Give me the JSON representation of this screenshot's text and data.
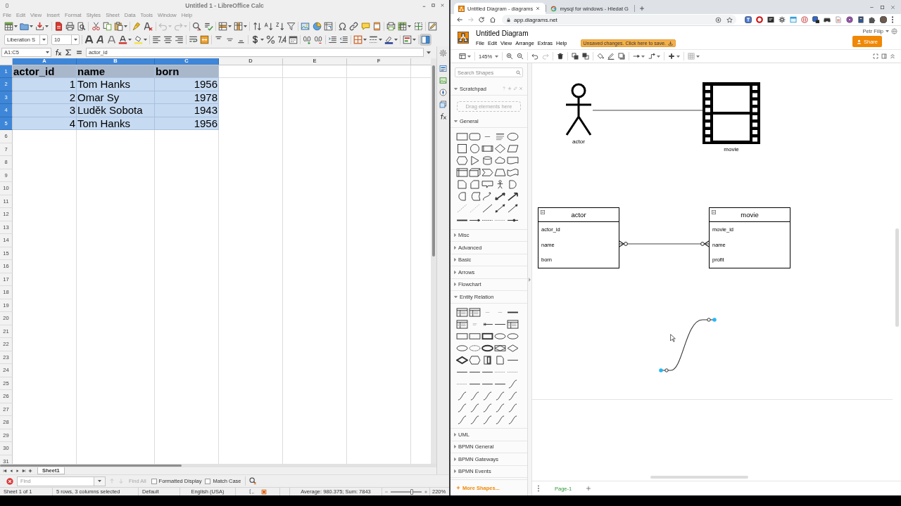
{
  "calc": {
    "title": "Untitled 1 - LibreOffice Calc",
    "menu": [
      "File",
      "Edit",
      "View",
      "Insert",
      "Format",
      "Styles",
      "Sheet",
      "Data",
      "Tools",
      "Window",
      "Help"
    ],
    "font_name": "Liberation S",
    "font_size": "10",
    "sidebar_toggle": {
      "on": true
    },
    "name_box": "A1:C5",
    "formula": "actor_id",
    "columns": [
      {
        "label": "A",
        "selected": true
      },
      {
        "label": "B",
        "selected": true
      },
      {
        "label": "C",
        "selected": true
      },
      {
        "label": "D",
        "selected": false
      },
      {
        "label": "E",
        "selected": false
      },
      {
        "label": "F",
        "selected": false
      }
    ],
    "rows": [
      {
        "number": "1",
        "selected": true,
        "cells": [
          {
            "kind": "header",
            "text": "actor_id"
          },
          {
            "kind": "header",
            "text": "name"
          },
          {
            "kind": "header",
            "text": "born"
          }
        ]
      },
      {
        "number": "2",
        "selected": true,
        "cells": [
          {
            "kind": "number",
            "text": "1"
          },
          {
            "kind": "text",
            "text": "Tom Hanks"
          },
          {
            "kind": "number",
            "text": "1956"
          }
        ]
      },
      {
        "number": "3",
        "selected": true,
        "cells": [
          {
            "kind": "number",
            "text": "2"
          },
          {
            "kind": "text",
            "text": "Omar Sy"
          },
          {
            "kind": "number",
            "text": "1978"
          }
        ]
      },
      {
        "number": "4",
        "selected": true,
        "cells": [
          {
            "kind": "number",
            "text": "3"
          },
          {
            "kind": "text",
            "text": "Luděk Sobota"
          },
          {
            "kind": "number",
            "text": "1943"
          }
        ]
      },
      {
        "number": "5",
        "selected": true,
        "cells": [
          {
            "kind": "number",
            "text": "4"
          },
          {
            "kind": "text",
            "text": "Tom Hanks"
          },
          {
            "kind": "number",
            "text": "1956"
          }
        ]
      },
      {
        "number": "6",
        "selected": false
      },
      {
        "number": "7",
        "selected": false
      },
      {
        "number": "8",
        "selected": false
      },
      {
        "number": "9",
        "selected": false
      },
      {
        "number": "10",
        "selected": false
      },
      {
        "number": "11",
        "selected": false
      },
      {
        "number": "12",
        "selected": false
      },
      {
        "number": "13",
        "selected": false
      },
      {
        "number": "14",
        "selected": false
      },
      {
        "number": "15",
        "selected": false
      },
      {
        "number": "16",
        "selected": false
      },
      {
        "number": "17",
        "selected": false
      },
      {
        "number": "18",
        "selected": false
      },
      {
        "number": "19",
        "selected": false
      },
      {
        "number": "20",
        "selected": false
      },
      {
        "number": "21",
        "selected": false
      },
      {
        "number": "22",
        "selected": false
      },
      {
        "number": "23",
        "selected": false
      },
      {
        "number": "24",
        "selected": false
      },
      {
        "number": "25",
        "selected": false
      },
      {
        "number": "26",
        "selected": false
      },
      {
        "number": "27",
        "selected": false
      },
      {
        "number": "28",
        "selected": false
      },
      {
        "number": "29",
        "selected": false
      },
      {
        "number": "30",
        "selected": false
      },
      {
        "number": "31",
        "selected": false
      }
    ],
    "sheet_tabs": [
      {
        "label": "Sheet1",
        "selected": true
      }
    ],
    "find": {
      "placeholder": "Find",
      "find_all": {
        "label": "Find All",
        "disabled": true
      },
      "options": [
        {
          "label": "Formatted Display",
          "checked": false
        },
        {
          "label": "Match Case",
          "checked": false
        }
      ]
    },
    "status_bar": {
      "sheet": "Sheet 1 of 1",
      "selection": "5 rows, 3 columns selected",
      "page_style": "Default",
      "language": "English (USA)",
      "summary": "Average: 980.375; Sum: 7843",
      "zoom_slider": {
        "level": 0.69
      },
      "zoom": "220%"
    }
  },
  "browser": {
    "tabs": [
      {
        "title": "Untitled Diagram - diagrams",
        "selected": true
      },
      {
        "title": "mysql for windows - Hledat G",
        "selected": false
      }
    ],
    "url": "app.diagrams.net"
  },
  "drawio": {
    "title": "Untitled Diagram",
    "menu": [
      "File",
      "Edit",
      "View",
      "Arrange",
      "Extras",
      "Help"
    ],
    "save_notice": "Unsaved changes. Click here to save.",
    "user": "Petr Filip",
    "share": "Share",
    "zoom": "145%",
    "sidebar": {
      "search_placeholder": "Search Shapes",
      "sections": [
        {
          "title": "Scratchpad",
          "kind": "scratchpad",
          "expanded": true,
          "hint": "Drag elements here"
        },
        {
          "title": "General",
          "kind": "general",
          "expanded": true
        },
        {
          "title": "Misc",
          "kind": "library",
          "expanded": false
        },
        {
          "title": "Advanced",
          "kind": "library",
          "expanded": false
        },
        {
          "title": "Basic",
          "kind": "library",
          "expanded": false
        },
        {
          "title": "Arrows",
          "kind": "library",
          "expanded": false
        },
        {
          "title": "Flowchart",
          "kind": "library",
          "expanded": false
        },
        {
          "title": "Entity Relation",
          "kind": "entity-relation",
          "expanded": true
        },
        {
          "title": "UML",
          "kind": "library",
          "expanded": false
        },
        {
          "title": "BPMN General",
          "kind": "library",
          "expanded": false
        },
        {
          "title": "BPMN Gateways",
          "kind": "library",
          "expanded": false
        },
        {
          "title": "BPMN Events",
          "kind": "library",
          "expanded": false
        }
      ],
      "more_shapes": "More Shapes..."
    },
    "canvas": {
      "figures": [
        {
          "kind": "actor",
          "label": "actor"
        },
        {
          "kind": "film",
          "label": "movie"
        }
      ],
      "tables": [
        {
          "title": "actor",
          "fields": [
            "actor_id",
            "name",
            "born"
          ]
        },
        {
          "title": "movie",
          "fields": [
            "movie_id",
            "name",
            "profit"
          ]
        }
      ],
      "connectors": [
        {
          "kind": "line",
          "selected": false
        },
        {
          "kind": "zero-or-many",
          "selected": false
        },
        {
          "kind": "curve",
          "selected": true
        }
      ]
    },
    "pages": [
      {
        "label": "Page-1",
        "selected": true
      }
    ]
  }
}
